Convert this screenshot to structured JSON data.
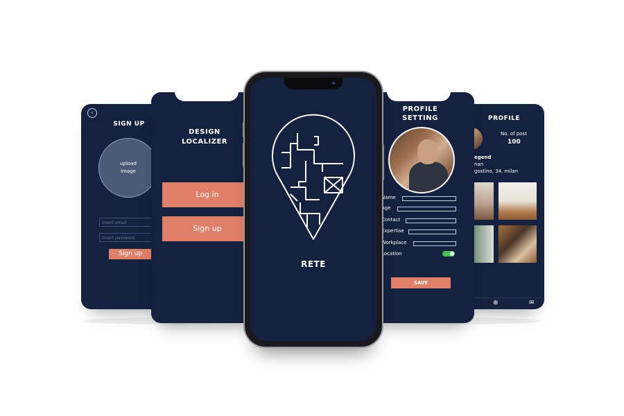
{
  "signup": {
    "back_icon": "chevron-left-icon",
    "title": "SIGN UP",
    "upload_line1": "upload",
    "upload_line2": "image",
    "email_placeholder": "insert email",
    "password_placeholder": "insert password",
    "button": "Sign up"
  },
  "design": {
    "title_line1": "DESIGN",
    "title_line2": "LOCALIZER",
    "login": "Log in",
    "signup": "Sign up"
  },
  "main": {
    "app_name": "RETE",
    "logo_icon": "map-pin-floorplan-icon"
  },
  "setting": {
    "title_line1": "PROFILE",
    "title_line2": "SETTING",
    "fields": [
      "Name",
      "Age",
      "Contact",
      "Expertise",
      "Workplace",
      "Location"
    ],
    "location_toggle": "on",
    "save": "SAVE"
  },
  "profile": {
    "title": "PROFILE",
    "posts_label": "No. of post",
    "posts_count": "100",
    "name_fragment": "egend",
    "role_fragment": "nan",
    "address_fragment": "gostino, 34, milan",
    "nav_icons": [
      "plus-circle-icon",
      "mail-icon"
    ]
  },
  "colors": {
    "screen_bg": "#14213f",
    "accent": "#e07f68",
    "toggle_on": "#43c34a"
  }
}
